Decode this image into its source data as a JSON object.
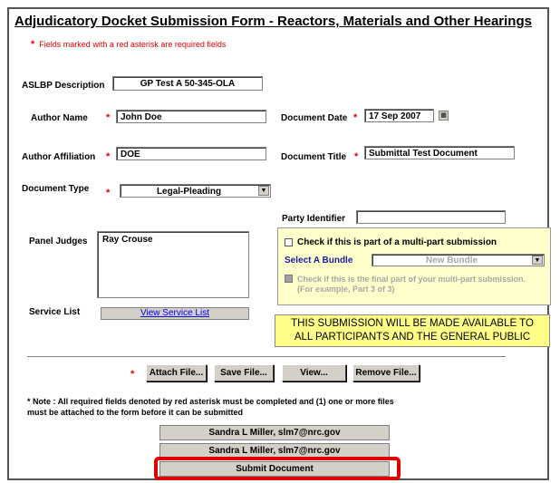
{
  "form": {
    "title": "Adjudicatory Docket Submission Form - Reactors, Materials and Other Hearings",
    "required_note": "Fields marked with a red asterisk are required  fields",
    "asterisk": "*"
  },
  "fields": {
    "aslbp_label": "ASLBP Description",
    "aslbp_value": "GP Test A 50-345-OLA",
    "author_name_label": "Author Name",
    "author_name_value": "John Doe",
    "document_date_label": "Document Date",
    "document_date_value": "17 Sep 2007",
    "author_affiliation_label": "Author Affiliation",
    "author_affiliation_value": "DOE",
    "document_title_label": "Document Title",
    "document_title_value": "Submittal Test Document",
    "document_type_label": "Document Type",
    "document_type_value": "Legal-Pleading",
    "party_identifier_label": "Party Identifier",
    "party_identifier_value": "",
    "panel_judges_label": "Panel Judges",
    "panel_judges_value": "Ray Crouse",
    "service_list_label": "Service List",
    "service_list_link": "View Service List"
  },
  "multipart": {
    "checkbox_label": "Check if this is part of a multi-part submission",
    "bundle_label": "Select A Bundle",
    "bundle_value": "New Bundle",
    "final_part_line1": "Check if this is the final part of your multi-part submission.",
    "final_part_line2": "(For example, Part 3 of 3)"
  },
  "notice": {
    "line1": "THIS SUBMISSION WILL BE MADE AVAILABLE TO",
    "line2": "ALL PARTICIPANTS AND THE GENERAL PUBLIC"
  },
  "file_buttons": {
    "attach": "Attach File...",
    "save": "Save File...",
    "view": "View...",
    "remove": "Remove File..."
  },
  "bottom_note": {
    "line1": "* Note : All required fields denoted by red asterisk must be completed and (1) one or more files",
    "line2": "must be attached to the form before it can be submitted"
  },
  "user_buttons": [
    "Sandra L Miller, slm7@nrc.gov",
    "Sandra L Miller, slm7@nrc.gov"
  ],
  "submit_label": "Submit Document",
  "icons": {
    "dropdown": "▼",
    "calendar": "▦"
  },
  "colors": {
    "required": "#e00000",
    "notice_bg": "#ffff88",
    "multipart_bg": "#ffffcc",
    "highlight": "#e00000"
  }
}
